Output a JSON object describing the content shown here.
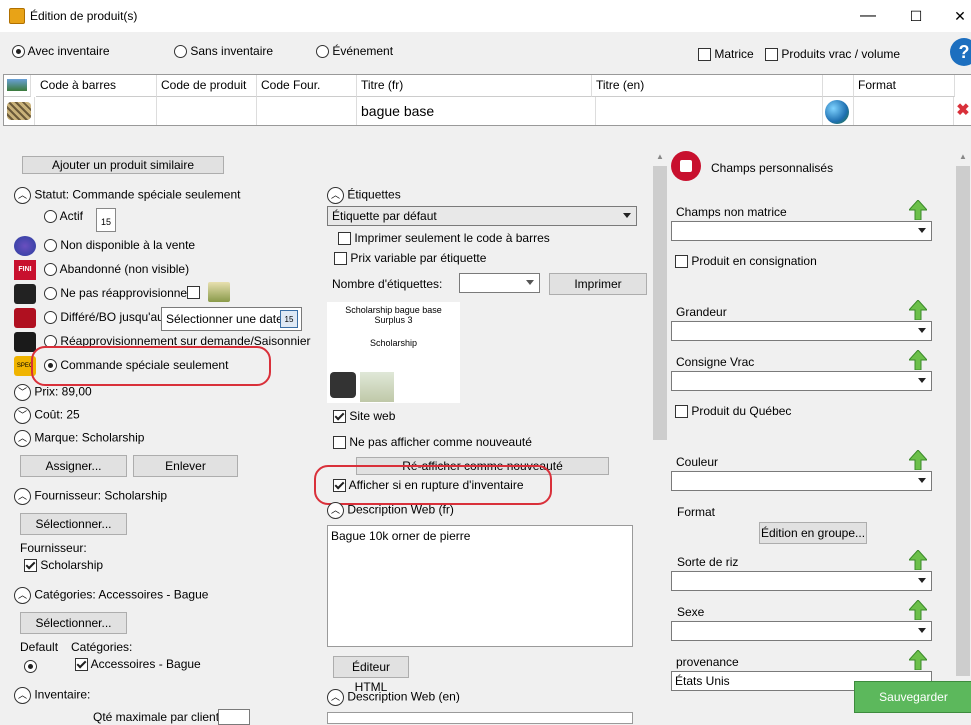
{
  "window": {
    "title": "Édition de produit(s)",
    "min": "—",
    "max": "☐",
    "close": "✕"
  },
  "top": {
    "modes": [
      "Avec inventaire",
      "Sans inventaire",
      "Événement"
    ],
    "matrice": "Matrice",
    "vrac": "Produits vrac / volume",
    "help": "?"
  },
  "grid": {
    "headers": [
      "Code à barres",
      "Code de produit",
      "Code Four.",
      "Titre (fr)",
      "Titre (en)",
      "Format"
    ],
    "row": {
      "titre_fr": "bague base"
    }
  },
  "left": {
    "similar_btn": "Ajouter un produit similaire",
    "statut_label": "Statut:",
    "statut_value": "Commande spéciale seulement",
    "options": [
      "Actif",
      "Non disponible à la vente",
      "Abandonné (non visible)",
      "Ne pas réapprovisionner",
      "Différé/BO jusqu'au",
      "Réapprovisionnement sur demande/Saisonnier",
      "Commande spéciale seulement"
    ],
    "date_placeholder": "Sélectionner une date",
    "cal_day": "15",
    "prix": "Prix: 89,00",
    "cout": "Coût: 25",
    "marque_label": "Marque:",
    "marque_value": "Scholarship",
    "assigner": "Assigner...",
    "enlever": "Enlever",
    "fournisseur_label": "Fournisseur:",
    "fournisseur_value": "Scholarship",
    "selectionner": "Sélectionner...",
    "fournisseur_sub": "Fournisseur:",
    "fournisseur_chk": "Scholarship",
    "categories_label": "Catégories:",
    "categories_value": "Accessoires - Bague",
    "default": "Default",
    "categories_sub": "Catégories:",
    "categories_chk": "Accessoires - Bague",
    "inventaire": "Inventaire:",
    "qte_max": "Qté maximale par client"
  },
  "middle": {
    "etiquettes": "Étiquettes",
    "etiquette_select": "Étiquette par défaut",
    "imprimer_code": "Imprimer seulement le code à barres",
    "prix_variable": "Prix variable par étiquette",
    "nb_etiquettes": "Nombre d'étiquettes:",
    "imprimer": "Imprimer",
    "preview_line1": "Scholarship bague base",
    "preview_line2": "Surplus 3",
    "preview_line3": "Scholarship",
    "site_web": "Site web",
    "ne_pas_afficher": "Ne pas afficher comme nouveauté",
    "reafficher": "Ré-afficher comme nouveauté",
    "afficher_rupture": "Afficher si en rupture d'inventaire",
    "desc_fr": "Description Web (fr)",
    "desc_fr_text": "Bague 10k  orner de pierre",
    "editeur": "Éditeur HTML",
    "desc_en": "Description Web (en)"
  },
  "right": {
    "champs_title": "Champs personnalisés",
    "champs_non_matrice": "Champs non matrice",
    "consignation": "Produit en consignation",
    "grandeur": "Grandeur",
    "consigne_vrac": "Consigne Vrac",
    "produit_quebec": "Produit du Québec",
    "couleur": "Couleur",
    "format": "Format",
    "edition_groupe": "Édition en groupe...",
    "sorte_riz": "Sorte de riz",
    "sexe": "Sexe",
    "provenance": "provenance",
    "provenance_value": "États Unis",
    "sauvegarder": "Sauvegarder"
  },
  "colors": {
    "accent_red": "#d9303a",
    "save_green": "#5cb85c",
    "arrow_green": "#6cc04a"
  }
}
